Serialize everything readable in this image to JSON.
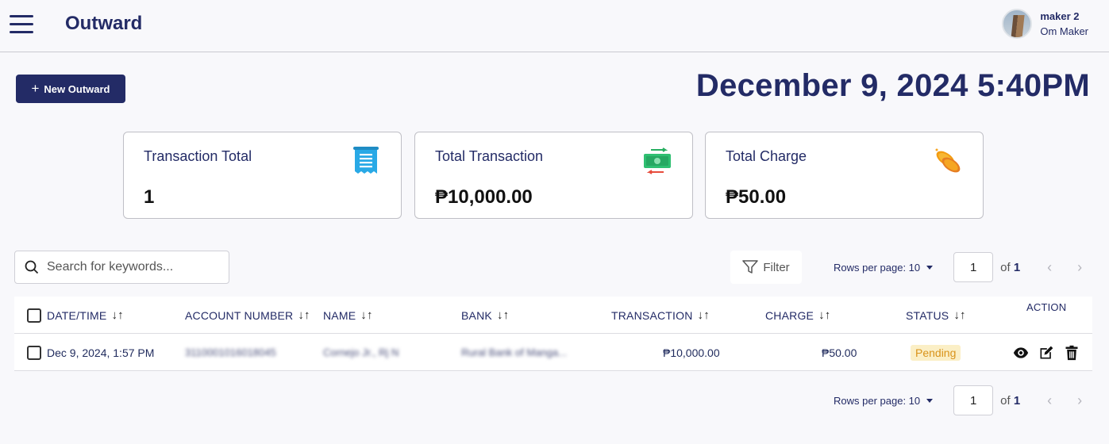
{
  "header": {
    "title": "Outward",
    "user_name": "maker 2",
    "user_role": "Om Maker"
  },
  "toolbar": {
    "new_button_label": "New Outward",
    "datetime": "December 9, 2024 5:40PM"
  },
  "cards": [
    {
      "title": "Transaction Total",
      "value": "1",
      "icon": "receipt-icon"
    },
    {
      "title": "Total Transaction",
      "value": "₱10,000.00",
      "icon": "money-transfer-icon"
    },
    {
      "title": "Total Charge",
      "value": "₱50.00",
      "icon": "coins-icon"
    }
  ],
  "search": {
    "placeholder": "Search for keywords..."
  },
  "filter": {
    "label": "Filter"
  },
  "pagination": {
    "rows_per_page_label": "Rows per page: 10",
    "current_page": "1",
    "of_label": "of",
    "total_pages": "1"
  },
  "table": {
    "columns": [
      "DATE/TIME",
      "ACCOUNT NUMBER",
      "NAME",
      "BANK",
      "TRANSACTION",
      "CHARGE",
      "STATUS",
      "ACTION"
    ],
    "rows": [
      {
        "datetime": "Dec 9, 2024, 1:57 PM",
        "account_number": "3110001016018045",
        "name": "Cornejo Jr., Rj N",
        "bank": "Rural Bank of Manga...",
        "transaction": "₱10,000.00",
        "charge": "₱50.00",
        "status": "Pending"
      }
    ]
  },
  "colors": {
    "primary": "#232b66",
    "pending_bg": "#fbefc6",
    "pending_text": "#d9931a"
  }
}
